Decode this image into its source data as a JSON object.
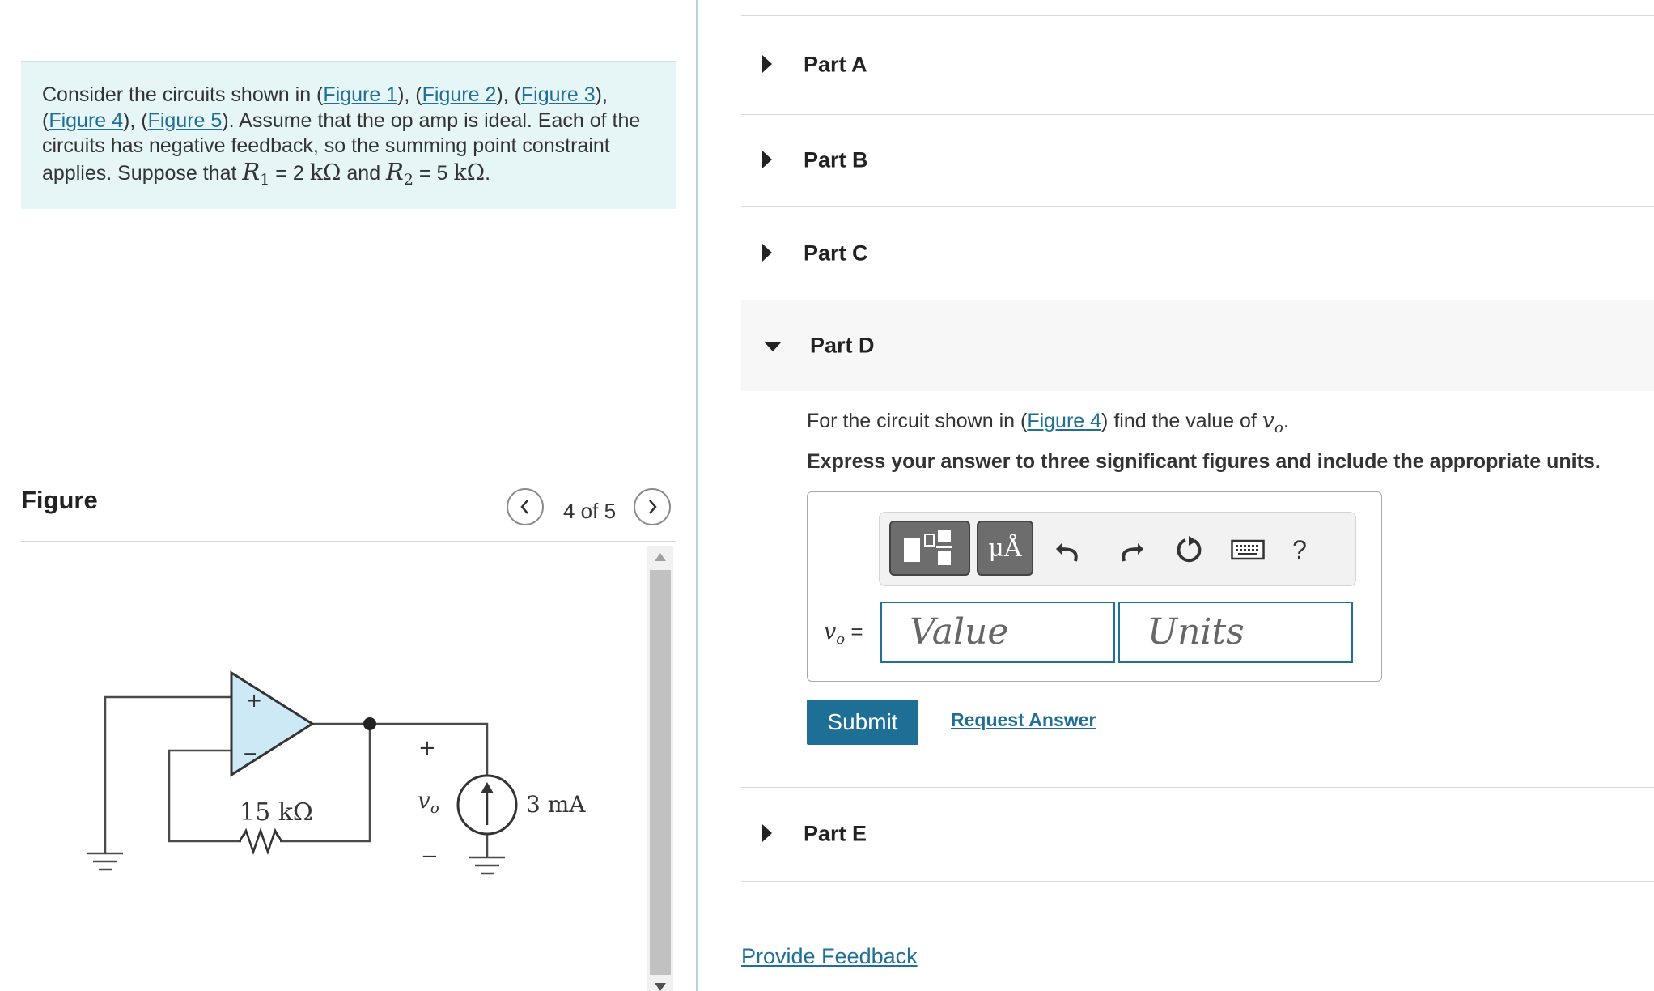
{
  "intro": {
    "t1": "Consider the circuits shown in (",
    "fig1": "Figure 1",
    "t2": "), (",
    "fig2": "Figure 2",
    "t3": "), (",
    "fig3": "Figure 3",
    "t4": "), (",
    "fig4": "Figure 4",
    "t5": "), (",
    "fig5": "Figure 5",
    "t6": "). Assume that the op amp is ideal. Each of the circuits has negative feedback, so the summing point constraint applies. Suppose that ",
    "r1": "R",
    "r1_sub": "1",
    "eq1": " = 2 ",
    "kohm1": "kΩ",
    "and": " and ",
    "r2": "R",
    "r2_sub": "2",
    "eq2": " = 5 ",
    "kohm2": "kΩ",
    "end": "."
  },
  "figure_panel": {
    "title": "Figure",
    "counter": "4 of 5",
    "circuit": {
      "resistor_label": "15 kΩ",
      "plus_input": "+",
      "minus_input": "−",
      "vo_plus": "+",
      "vo_label": "v",
      "vo_sub": "o",
      "vo_minus": "−",
      "source_label": "3 mA"
    }
  },
  "parts": {
    "a": "Part A",
    "b": "Part B",
    "c": "Part C",
    "d": "Part D",
    "e": "Part E"
  },
  "part_d": {
    "q1": "For the circuit shown in (",
    "q_link": "Figure 4",
    "q2": ") find the value of ",
    "q_var": "v",
    "q_var_sub": "o",
    "q3": ".",
    "instruction": "Express your answer to three significant figures and include the appropriate units.",
    "toolbar": {
      "units_button": "μÅ",
      "help": "?"
    },
    "answer_label_var": "v",
    "answer_label_sub": "o",
    "answer_label_eq": " =",
    "value_placeholder": "Value",
    "units_placeholder": "Units",
    "submit": "Submit",
    "request_answer": "Request Answer"
  },
  "feedback": "Provide Feedback",
  "colors": {
    "link": "#1f6f98",
    "submit_bg": "#1e6f96",
    "intro_bg": "#e6f5f5",
    "opamp_fill": "#cde9f6"
  }
}
